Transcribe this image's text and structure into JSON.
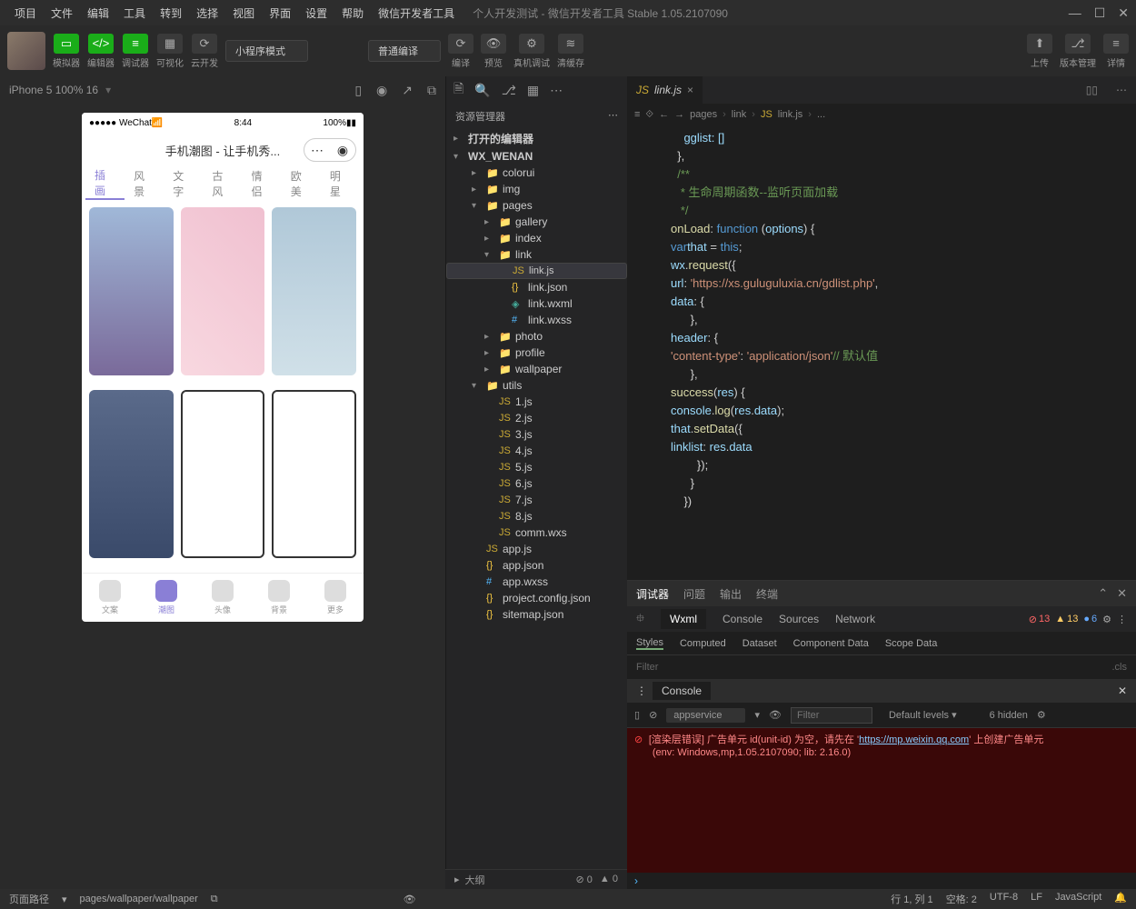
{
  "menubar": {
    "items": [
      "项目",
      "文件",
      "编辑",
      "工具",
      "转到",
      "选择",
      "视图",
      "界面",
      "设置",
      "帮助",
      "微信开发者工具"
    ],
    "title": "个人开发测试 - 微信开发者工具 Stable 1.05.2107090"
  },
  "toolbar": {
    "btns": [
      {
        "label": "模拟器"
      },
      {
        "label": "编辑器"
      },
      {
        "label": "调试器"
      },
      {
        "label": "可视化"
      },
      {
        "label": "云开发"
      }
    ],
    "mode": "小程序模式",
    "compile": "普通编译",
    "actions": [
      "编译",
      "预览",
      "真机调试",
      "清缓存"
    ],
    "right": [
      "上传",
      "版本管理",
      "详情"
    ]
  },
  "sim": {
    "device": "iPhone 5 100% 16",
    "status_l": "●●●●● WeChat",
    "status_time": "8:44",
    "status_r": "100%",
    "page_title": "手机潮图 - 让手机秀...",
    "tabs": [
      "插画",
      "风景",
      "文字",
      "古风",
      "情侣",
      "欧美",
      "明星"
    ],
    "nav": [
      "文案",
      "潮图",
      "头像",
      "背景",
      "更多"
    ]
  },
  "explorer": {
    "title": "资源管理器",
    "sections": [
      "打开的编辑器",
      "WX_WENAN"
    ],
    "tree": [
      {
        "n": "colorui",
        "t": "folder",
        "d": 2
      },
      {
        "n": "img",
        "t": "folder",
        "d": 2
      },
      {
        "n": "pages",
        "t": "folder",
        "d": 2,
        "open": true
      },
      {
        "n": "gallery",
        "t": "folder",
        "d": 3
      },
      {
        "n": "index",
        "t": "folder",
        "d": 3
      },
      {
        "n": "link",
        "t": "folder",
        "d": 3,
        "open": true
      },
      {
        "n": "link.js",
        "t": "js",
        "d": 4,
        "sel": true
      },
      {
        "n": "link.json",
        "t": "json",
        "d": 4
      },
      {
        "n": "link.wxml",
        "t": "wxml",
        "d": 4
      },
      {
        "n": "link.wxss",
        "t": "wxss",
        "d": 4
      },
      {
        "n": "photo",
        "t": "folder",
        "d": 3
      },
      {
        "n": "profile",
        "t": "folder",
        "d": 3
      },
      {
        "n": "wallpaper",
        "t": "folder",
        "d": 3
      },
      {
        "n": "utils",
        "t": "folder",
        "d": 2,
        "open": true
      },
      {
        "n": "1.js",
        "t": "js",
        "d": 3
      },
      {
        "n": "2.js",
        "t": "js",
        "d": 3
      },
      {
        "n": "3.js",
        "t": "js",
        "d": 3
      },
      {
        "n": "4.js",
        "t": "js",
        "d": 3
      },
      {
        "n": "5.js",
        "t": "js",
        "d": 3
      },
      {
        "n": "6.js",
        "t": "js",
        "d": 3
      },
      {
        "n": "7.js",
        "t": "js",
        "d": 3
      },
      {
        "n": "8.js",
        "t": "js",
        "d": 3
      },
      {
        "n": "comm.wxs",
        "t": "js",
        "d": 3
      },
      {
        "n": "app.js",
        "t": "js",
        "d": 2
      },
      {
        "n": "app.json",
        "t": "json",
        "d": 2
      },
      {
        "n": "app.wxss",
        "t": "wxss",
        "d": 2
      },
      {
        "n": "project.config.json",
        "t": "json",
        "d": 2
      },
      {
        "n": "sitemap.json",
        "t": "json",
        "d": 2
      }
    ]
  },
  "editor": {
    "tab": "link.js",
    "breadcrumb": [
      "pages",
      "link",
      "link.js",
      "..."
    ],
    "code": [
      {
        "t": "    gglist: []",
        "c": "v"
      },
      {
        "t": "  },",
        "c": "p"
      },
      {
        "t": "",
        "c": "p"
      },
      {
        "t": "  /**",
        "c": "c"
      },
      {
        "t": "   * 生命周期函数--监听页面加载",
        "c": "c"
      },
      {
        "t": "   */",
        "c": "c"
      },
      {
        "t": "  onLoad: function (options) {",
        "c": "mix1"
      },
      {
        "t": "    var that = this;",
        "c": "mix2"
      },
      {
        "t": "    wx.request({",
        "c": "mix3"
      },
      {
        "t": "      url: 'https://xs.guluguluxia.cn/gdlist.php',",
        "c": "mix4"
      },
      {
        "t": "      data: {",
        "c": "mix5"
      },
      {
        "t": "      },",
        "c": "p"
      },
      {
        "t": "      header: {",
        "c": "mix5"
      },
      {
        "t": "        'content-type': 'application/json' // 默认值",
        "c": "mix6"
      },
      {
        "t": "      },",
        "c": "p"
      },
      {
        "t": "      success(res) {",
        "c": "mix7"
      },
      {
        "t": "        console.log(res.data);",
        "c": "mix8"
      },
      {
        "t": "        that.setData({",
        "c": "mix9"
      },
      {
        "t": "          linklist: res.data",
        "c": "mix10"
      },
      {
        "t": "        });",
        "c": "p"
      },
      {
        "t": "      }",
        "c": "p"
      },
      {
        "t": "    })",
        "c": "p"
      }
    ]
  },
  "devtools": {
    "head": [
      "调试器",
      "问题",
      "输出",
      "终端"
    ],
    "tabs": [
      "Wxml",
      "Console",
      "Sources",
      "Network"
    ],
    "err": "13",
    "warn": "13",
    "info": "6",
    "styles": [
      "Styles",
      "Computed",
      "Dataset",
      "Component Data",
      "Scope Data"
    ],
    "filter": "Filter",
    "cls": ".cls",
    "console_title": "Console",
    "context": "appservice",
    "levels": "Default levels",
    "hidden": "6 hidden",
    "log1": "[渲染层错误] 广告单元 id(unit-id) 为空，请先在 '",
    "log1_url": "https://mp.weixin.qq.com",
    "log1_end": "' 上创建广告单元",
    "log2": "(env: Windows,mp,1.05.2107090; lib: 2.16.0)"
  },
  "outline": {
    "label": "大纲",
    "err": "0",
    "warn": "0"
  },
  "statusbar": {
    "path_label": "页面路径",
    "path": "pages/wallpaper/wallpaper",
    "pos": "行 1, 列 1",
    "spaces": "空格: 2",
    "enc": "UTF-8",
    "eol": "LF",
    "lang": "JavaScript"
  }
}
